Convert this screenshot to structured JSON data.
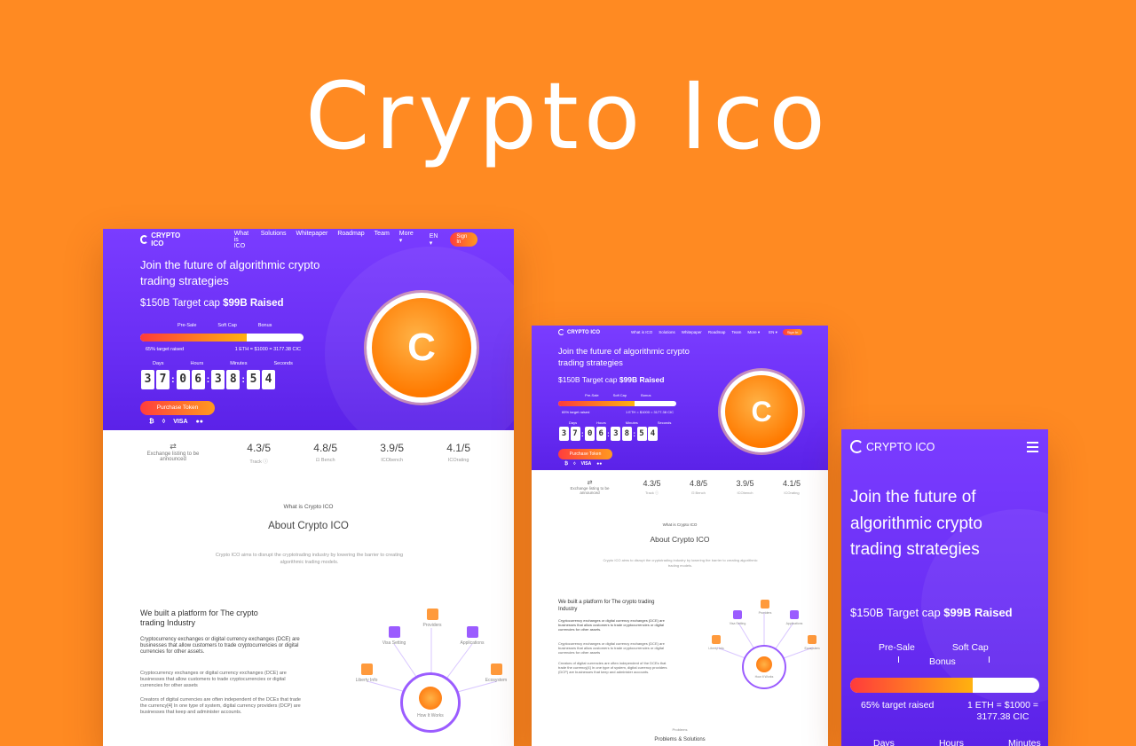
{
  "banner": {
    "title": "Crypto Ico"
  },
  "brand": {
    "logo_text": "CRYPTO ICO",
    "accent": "#ff8a22",
    "purple": "#6b2ff5",
    "orange_gradient": [
      "#ff3d3d",
      "#ff9a1f"
    ]
  },
  "desktop": {
    "nav": {
      "links": [
        "What is ICO",
        "Solutions",
        "Whitepaper",
        "Roadmap",
        "Team",
        "More ▾"
      ],
      "lang": "EN ▾",
      "signin": "Sign In"
    },
    "headline": "Join the future of algorithmic crypto trading strategies",
    "target_prefix": "$150B Target cap ",
    "target_raised": "$99B Raised",
    "stages": [
      "Pre-Sale",
      "Soft Cap",
      "Bonus"
    ],
    "progress_percent": 65,
    "progress_label": "65% target raised",
    "rate": "1 ETH = $1000 = 3177.38 CIC",
    "countdown_labels": [
      "Days",
      "Hours",
      "Minutes",
      "Seconds"
    ],
    "countdown_digits": [
      "3",
      "7",
      "0",
      "6",
      "3",
      "8",
      "5",
      "4"
    ],
    "purchase": "Purchase Token",
    "payments": [
      "₿",
      "◊",
      "VISA",
      "●●"
    ],
    "coin_symbol": "C",
    "ratings": [
      {
        "score": "",
        "sub": "Exchange listing to be announced"
      },
      {
        "score": "4.3/5",
        "sub": "Track ⓘ"
      },
      {
        "score": "4.8/5",
        "sub": "⊡ Bench"
      },
      {
        "score": "3.9/5",
        "sub": "ICObench"
      },
      {
        "score": "4.1/5",
        "sub": "ICOrating"
      }
    ],
    "what_label": "What is Crypto ICO",
    "about_title": "About Crypto ICO",
    "about_text": "Crypto ICO aims to disrupt the cryptotrading industry by lowering the barrier to creating algorithmic trading models.",
    "platform_title": "We built a platform for The crypto trading Industry",
    "paragraphs": [
      "Cryptocurrency exchanges or digital currency exchanges (DCE) are businesses that allow customers to trade cryptocurrencies or digital currencies for other assets.",
      "Cryptocurrency exchanges or digital currency exchanges (DCE) are businesses that allow customers to trade cryptocurrencies or digital currencies for other assets",
      "Creators of digital currencies are often independent of the DCEs that trade the currency[4] In one type of system, digital currency providers (DCP) are businesses that keep and administer accounts."
    ],
    "diagram": {
      "nodes": [
        "Providers",
        "Visa Setting",
        "Applications",
        "Liberty Info",
        "Ecosystem"
      ],
      "hub": "How It Works"
    }
  },
  "tablet": {
    "headline": "Join the future of algorithmic crypto trading strategies",
    "target_prefix": "$150B Target cap ",
    "target_raised": "$99B Raised",
    "ratings": [
      "4.3/5",
      "4.8/5",
      "3.9/5",
      "4.1/5"
    ],
    "about_title": "About Crypto ICO",
    "platform_title": "We built a platform for The crypto trading Industry",
    "problems_label": "Problems",
    "problems_title": "Problems & Solutions"
  },
  "mobile": {
    "headline": "Join the future of algorithmic crypto trading strategies",
    "target_prefix": "$150B Target cap ",
    "target_raised": "$99B Raised",
    "stage_presale": "Pre-Sale",
    "stage_softcap": "Soft Cap",
    "stage_bonus": "Bonus",
    "progress_label": "65% target raised",
    "rate": "1 ETH = $1000 = 3177.38 CIC",
    "countdown_labels": [
      "Days",
      "Hours",
      "Minutes"
    ]
  }
}
